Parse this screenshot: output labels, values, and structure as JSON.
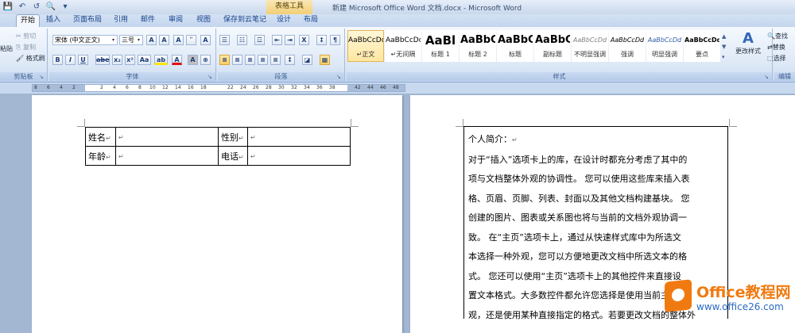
{
  "quick_access": {
    "save": "💾",
    "undo": "↶",
    "redo": "↺",
    "print_preview": "🔍",
    "more": "▾"
  },
  "window": {
    "title": "新建 Microsoft Office Word 文档.docx - Microsoft Word",
    "context_tab": "表格工具"
  },
  "tabs": [
    "开始",
    "插入",
    "页面布局",
    "引用",
    "邮件",
    "审阅",
    "视图",
    "保存到云笔记",
    "设计",
    "布局"
  ],
  "ribbon": {
    "clipboard": {
      "label": "剪贴板",
      "paste": "粘贴",
      "cut": "剪切",
      "copy": "复制",
      "format_painter": "格式刷"
    },
    "font": {
      "label": "字体",
      "name": "宋体 (中文正文)",
      "size": "三号",
      "grow": "A",
      "shrink": "A",
      "clear": "A",
      "phonetic": "ʺ",
      "border": "A",
      "bold": "B",
      "italic": "I",
      "underline": "U",
      "strike": "abe",
      "sub": "x₂",
      "sup": "x²",
      "case": "Aa",
      "highlight": "ab",
      "color": "A",
      "charshade": "A",
      "enclose": "⊕"
    },
    "paragraph": {
      "label": "段落",
      "bullets": "☰",
      "numbering": "☷",
      "multilevel": "☲",
      "decrease": "⇤",
      "increase": "⇥",
      "chinese_layout": "X",
      "sort": "↕",
      "show_marks": "¶",
      "align_left": "≡",
      "center": "≡",
      "align_right": "≡",
      "justify": "≡",
      "distribute": "≡",
      "line_spacing": "↕",
      "shading": "◪",
      "borders": "▦"
    },
    "styles": {
      "label": "样式",
      "items": [
        {
          "sample": "AaBbCcDd",
          "name": "↵正文"
        },
        {
          "sample": "AaBbCcDd",
          "name": "↵无间隔"
        },
        {
          "sample": "AaBl",
          "name": "标题 1"
        },
        {
          "sample": "AaBbC",
          "name": "标题 2"
        },
        {
          "sample": "AaBbC",
          "name": "标题"
        },
        {
          "sample": "AaBbC",
          "name": "副标题"
        },
        {
          "sample": "AaBbCcDd",
          "name": "不明显强调"
        },
        {
          "sample": "AaBbCcDd",
          "name": "强调"
        },
        {
          "sample": "AaBbCcDd",
          "name": "明显强调"
        },
        {
          "sample": "AaBbCcDd",
          "name": "要点"
        }
      ],
      "change": "更改样式"
    },
    "editing": {
      "label": "编辑",
      "find": "查找",
      "replace": "替换",
      "select": "选择"
    }
  },
  "ruler": [
    "8",
    "6",
    "4",
    "2",
    "",
    "2",
    "4",
    "6",
    "8",
    "10",
    "12",
    "14",
    "16",
    "18",
    "",
    "22",
    "24",
    "26",
    "28",
    "30",
    "32",
    "34",
    "36",
    "38",
    "",
    "42",
    "44",
    "46",
    "48"
  ],
  "table1": {
    "rows": [
      [
        "姓名",
        "",
        "性别",
        ""
      ],
      [
        "年龄",
        "",
        "电话",
        ""
      ]
    ]
  },
  "bio": {
    "title": "个人简介：",
    "lines": [
      "对于“插入”选项卡上的库，在设计时都充分考虑了其中的",
      "项与文档整体外观的协调性。 您可以使用这些库来插入表",
      "格、页眉、页脚、列表、封面以及其他文档构建基块。 您",
      "创建的图片、图表或关系图也将与当前的文档外观协调一",
      "致。 在“主页”选项卡上，通过从快速样式库中为所选文",
      "本选择一种外观，您可以方便地更改文档中所选文本的格",
      "式。 您还可以使用“主页”选项卡上的其他控件来直接设",
      "置文本格式。大多数控件都允许您选择是使用当前主题外",
      "观，还是使用某种直接指定的格式。若要更改文档的整体外"
    ]
  },
  "watermark": {
    "brand": "Office教程网",
    "url": "www.office26.com"
  },
  "colors": {
    "accent": "#f07a10",
    "ribbon": "#dde8f6",
    "workspace": "#a3b7d2"
  }
}
